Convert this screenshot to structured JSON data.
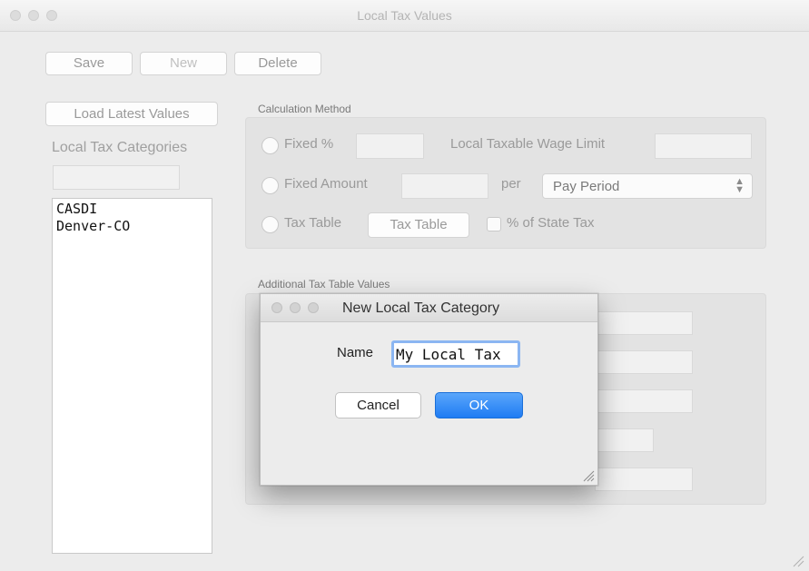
{
  "window": {
    "title": "Local Tax Values"
  },
  "toolbar": {
    "save_label": "Save",
    "new_label": "New",
    "delete_label": "Delete"
  },
  "left": {
    "load_latest_label": "Load Latest Values",
    "categories_label": "Local Tax Categories",
    "search_value": "",
    "categories": [
      "CASDI",
      "Denver-CO"
    ]
  },
  "calc": {
    "group_label": "Calculation Method",
    "fixed_percent_label": "Fixed %",
    "fixed_percent_value": "",
    "wage_limit_label": "Local Taxable Wage Limit",
    "wage_limit_value": "",
    "fixed_amount_label": "Fixed Amount",
    "fixed_amount_value": "",
    "per_label": "per",
    "pay_period_selected": "Pay Period",
    "tax_table_label": "Tax Table",
    "tax_table_button": "Tax Table",
    "percent_state_label": "% of State Tax"
  },
  "additional": {
    "group_label": "Additional Tax Table Values"
  },
  "dialog": {
    "title": "New Local Tax Category",
    "name_label": "Name",
    "name_value": "My Local Tax",
    "cancel_label": "Cancel",
    "ok_label": "OK"
  },
  "colors": {
    "accent": "#1f7cf3",
    "focus_ring": "#8bb6f2",
    "window_bg": "#ececec"
  }
}
